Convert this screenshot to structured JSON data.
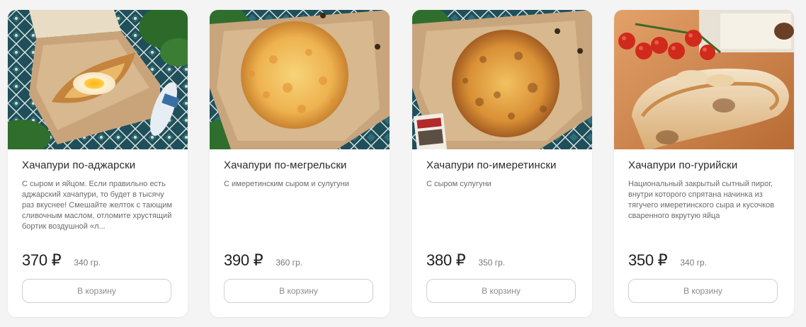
{
  "products": [
    {
      "title": "Хачапури по-аджарски",
      "description": "С сыром и яйцом.  Если правильно есть аджарский хачапури, то будет в тысячу раз вкуснее! Смешайте желток с тающим сливочным маслом, отломите хрустящий бортик воздушной «л...",
      "price": "370 ₽",
      "weight": "340 гр.",
      "button_label": "В корзину",
      "image": "adjarian-khachapuri-photo"
    },
    {
      "title": "Хачапури по-мегрельски",
      "description": "С имеретинским сыром и сулугуни",
      "price": "390 ₽",
      "weight": "360 гр.",
      "button_label": "В корзину",
      "image": "megrelian-khachapuri-photo"
    },
    {
      "title": "Хачапури по-имеретински",
      "description": "С сыром сулугуни",
      "price": "380 ₽",
      "weight": "350 гр.",
      "button_label": "В корзину",
      "image": "imeretian-khachapuri-photo"
    },
    {
      "title": "Хачапури по-гурийски",
      "description": "Национальный закрытый сытный пирог, внутри которого спрятана начинка из тягучего имеретинского сыра и кусочков сваренного вкрутую яйца",
      "price": "350 ₽",
      "weight": "340 гр.",
      "button_label": "В корзину",
      "image": "gurian-khachapuri-photo"
    }
  ],
  "colors": {
    "page_background": "#f4f4f4",
    "card_background": "#ffffff",
    "title_text": "#2b2b2b",
    "description_text": "#6b6b6b",
    "price_text": "#1f1f1f",
    "button_border": "#cfcfcf",
    "button_text": "#8c8c8c"
  }
}
